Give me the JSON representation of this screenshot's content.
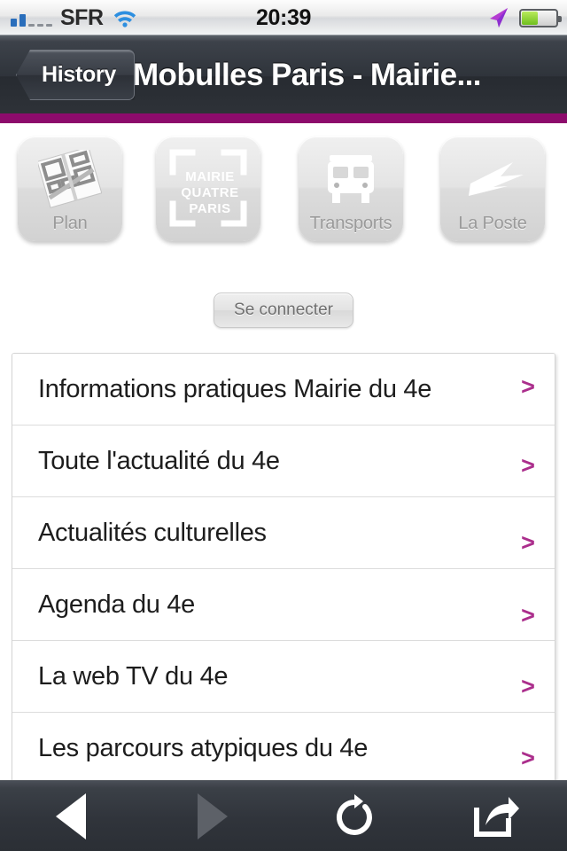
{
  "status_bar": {
    "signal_icon": "signal-bars-icon",
    "signal_bars_filled": 2,
    "signal_bars_total": 5,
    "carrier": "SFR",
    "wifi_icon": "wifi-icon",
    "time": "20:39",
    "location_icon": "location-arrow-icon",
    "battery_icon": "battery-icon",
    "battery_percent": 44
  },
  "nav_bar": {
    "back_label": "History",
    "title": "Mobulles Paris - Mairie...",
    "brand_color": "#8d0b6c"
  },
  "icons": [
    {
      "label": "Plan",
      "icon_name": "map-tile-icon",
      "label_inside": true
    },
    {
      "label": "",
      "icon_name": "mairie-quatre-paris-logo-icon",
      "logo_lines": [
        "MAIRIE",
        "QUATRE",
        "PARIS"
      ],
      "label_inside": false
    },
    {
      "label": "Transports",
      "icon_name": "bus-icon",
      "label_inside": true
    },
    {
      "label": "La Poste",
      "icon_name": "la-poste-bird-icon",
      "label_inside": true
    }
  ],
  "connect": {
    "label": "Se connecter"
  },
  "list": {
    "chevron_glyph": ">",
    "chevron_color": "#ab2e8c",
    "items": [
      {
        "label": "Informations pratiques Mairie du 4e"
      },
      {
        "label": "Toute l'actualité du 4e"
      },
      {
        "label": "Actualités culturelles"
      },
      {
        "label": "Agenda du 4e"
      },
      {
        "label": "La web TV du 4e"
      },
      {
        "label": "Les parcours atypiques du 4e"
      }
    ]
  },
  "toolbar": {
    "buttons": [
      {
        "name": "back-button",
        "icon": "triangle-left-icon",
        "enabled": true
      },
      {
        "name": "forward-button",
        "icon": "triangle-right-icon",
        "enabled": false
      },
      {
        "name": "reload-button",
        "icon": "reload-icon",
        "enabled": true
      },
      {
        "name": "share-button",
        "icon": "share-icon",
        "enabled": true
      }
    ]
  }
}
